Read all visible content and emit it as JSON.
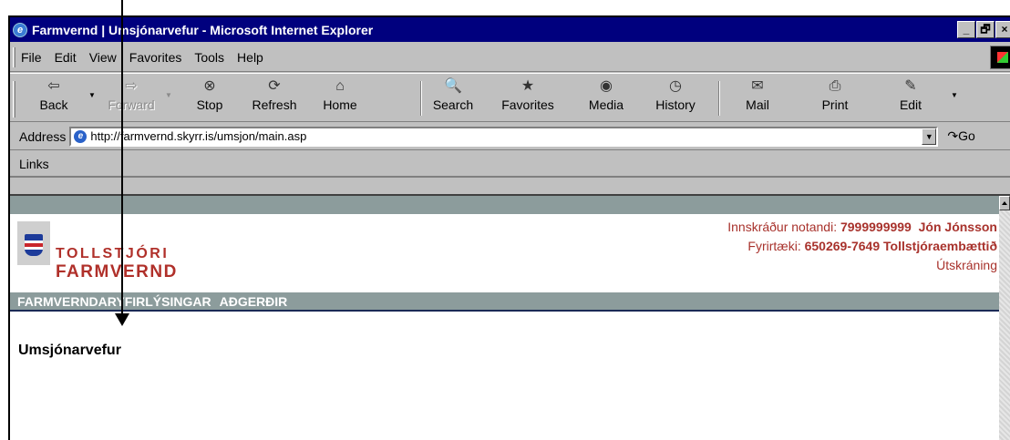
{
  "window": {
    "title": "Farmvernd | Umsjónarvefur - Microsoft Internet Explorer",
    "controls": [
      "_",
      "🗗",
      "×"
    ]
  },
  "menubar": {
    "items": [
      "File",
      "Edit",
      "View",
      "Favorites",
      "Tools",
      "Help"
    ]
  },
  "toolbar": {
    "buttons": [
      {
        "label": "Back",
        "glyph": "⇦"
      },
      {
        "label": "Forward",
        "glyph": "⇨"
      },
      {
        "label": "Stop",
        "glyph": "⊗"
      },
      {
        "label": "Refresh",
        "glyph": "⟳"
      },
      {
        "label": "Home",
        "glyph": "⌂"
      },
      {
        "label": "Search",
        "glyph": "🔍"
      },
      {
        "label": "Favorites",
        "glyph": "★"
      },
      {
        "label": "Media",
        "glyph": "◉"
      },
      {
        "label": "History",
        "glyph": "◷"
      },
      {
        "label": "Mail",
        "glyph": "✉"
      },
      {
        "label": "Print",
        "glyph": "⎙"
      },
      {
        "label": "Edit",
        "glyph": "✎"
      }
    ]
  },
  "addressbar": {
    "label": "Address",
    "url": "http://farmvernd.skyrr.is/umsjon/main.asp",
    "go_label": "Go"
  },
  "linksbar": {
    "label": "Links"
  },
  "page": {
    "logo_line1": "TOLLSTJÓRI",
    "logo_line2": "FARMVERND",
    "user_label": "Innskráður notandi:",
    "user_id": "7999999999",
    "user_name": "Jón Jónsson",
    "company_label": "Fyrirtæki:",
    "company_id": "650269-7649",
    "company_name": "Tollstjóraembættið",
    "logout": "Útskráning",
    "nav": [
      "FARMVERNDARYFIRLÝSINGAR",
      "AÐGERÐIR"
    ],
    "heading": "Umsjónarvefur"
  }
}
